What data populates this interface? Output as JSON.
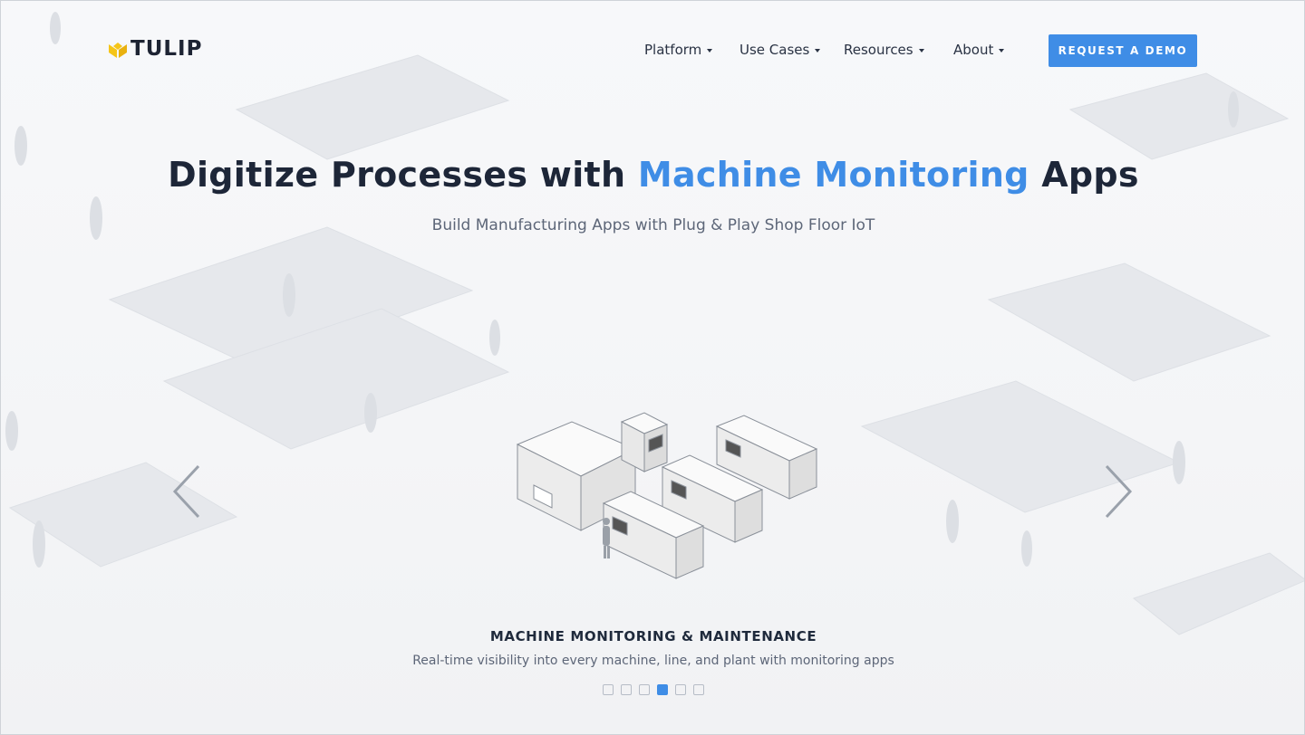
{
  "brand": {
    "name": "TULIP",
    "accent_color": "#f5c518",
    "logo_icon": "tulip-icon"
  },
  "nav": {
    "items": [
      {
        "label": "Platform"
      },
      {
        "label": "Use Cases"
      },
      {
        "label": "Resources"
      },
      {
        "label": "About"
      }
    ],
    "cta_label": "REQUEST A DEMO",
    "cta_color": "#3f8de6"
  },
  "hero": {
    "title_pre": "Digitize Processes with ",
    "title_accent": "Machine Monitoring",
    "title_post": " Apps",
    "subtitle": "Build Manufacturing Apps with Plug & Play Shop Floor IoT"
  },
  "carousel": {
    "slide_title": "MACHINE MONITORING & MAINTENANCE",
    "slide_description": "Real-time visibility into every machine, line, and plant with monitoring apps",
    "total_slides": 6,
    "active_index": 3,
    "prev_icon": "chevron-left-icon",
    "next_icon": "chevron-right-icon"
  }
}
